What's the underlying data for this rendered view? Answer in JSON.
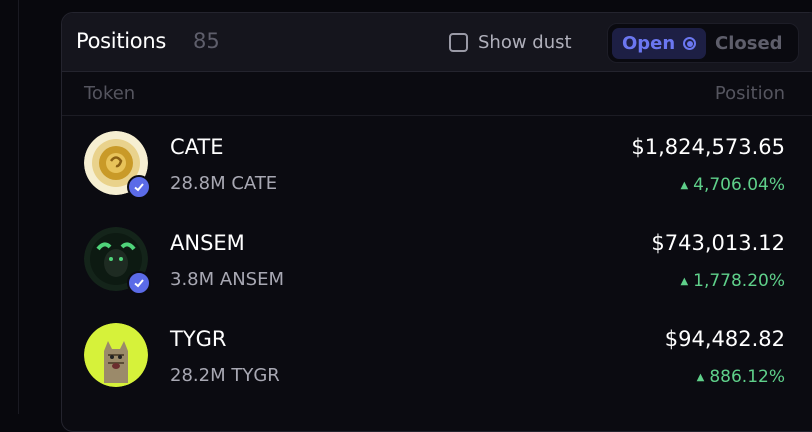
{
  "positions": {
    "title": "Positions",
    "count": "85",
    "show_dust_label": "Show dust",
    "tabs": {
      "open": "Open",
      "closed": "Closed"
    },
    "columns": {
      "token": "Token",
      "position": "Position"
    },
    "rows": [
      {
        "symbol": "CATE",
        "amount": "28.8M CATE",
        "value": "$1,824,573.65",
        "change": "4,706.04%",
        "verified": true
      },
      {
        "symbol": "ANSEM",
        "amount": "3.8M ANSEM",
        "value": "$743,013.12",
        "change": "1,778.20%",
        "verified": true
      },
      {
        "symbol": "TYGR",
        "amount": "28.2M TYGR",
        "value": "$94,482.82",
        "change": "886.12%",
        "verified": false
      }
    ]
  },
  "colors": {
    "accent": "#6b77f0",
    "positive": "#5fd08a",
    "verified": "#5b6be8"
  }
}
